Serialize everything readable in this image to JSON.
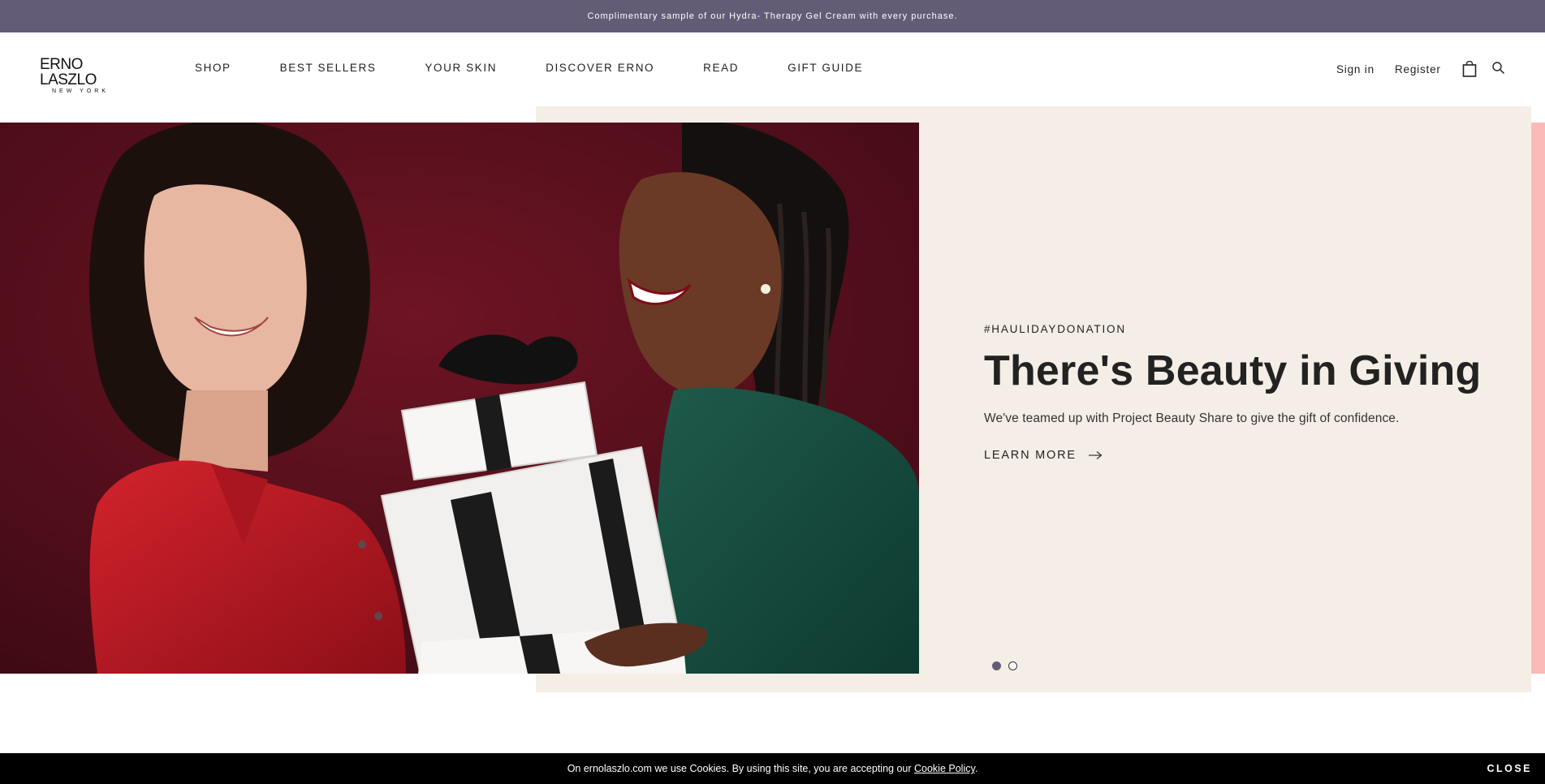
{
  "promo": {
    "text": "Complimentary sample of our Hydra- Therapy Gel Cream with every purchase."
  },
  "brand": {
    "logo_main": "ERNO LASZLO",
    "logo_sub": "NEW YORK"
  },
  "nav": {
    "items": [
      {
        "label": "SHOP"
      },
      {
        "label": "BEST SELLERS"
      },
      {
        "label": "YOUR SKIN"
      },
      {
        "label": "DISCOVER ERNO"
      },
      {
        "label": "READ"
      },
      {
        "label": "GIFT GUIDE"
      }
    ]
  },
  "account": {
    "signin": "Sign in",
    "register": "Register"
  },
  "icons": {
    "bag": "shopping-bag-icon",
    "search": "search-icon",
    "arrow": "arrow-right-icon"
  },
  "hero": {
    "eyebrow": "#HAULIDAYDONATION",
    "headline": "There's Beauty in Giving",
    "subcopy": "We've teamed up with Project Beauty Share to give the gift of confidence.",
    "cta": "LEARN MORE",
    "slide_count": 2,
    "active_slide": 1
  },
  "cookie": {
    "text_before": "On ernolaszlo.com we use Cookies. By using this site, you are accepting our ",
    "link": "Cookie Policy",
    "text_after": ".",
    "close": "CLOSE"
  },
  "colors": {
    "promo_bg": "#625c76",
    "panel_bg": "#f5eee6",
    "pink_accent": "#fbb9b7",
    "photo_bg": "#5a0f1c",
    "cookie_bg": "#000000"
  }
}
